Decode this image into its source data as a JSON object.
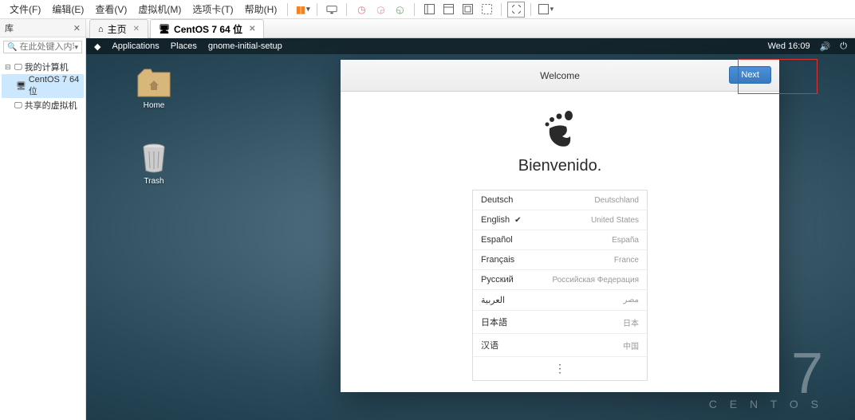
{
  "menubar": {
    "items": [
      "文件(F)",
      "编辑(E)",
      "查看(V)",
      "虚拟机(M)",
      "选项卡(T)",
      "帮助(H)"
    ]
  },
  "sidebar": {
    "title": "库",
    "search_placeholder": "在此处键入内容...",
    "tree": {
      "root": "我的计算机",
      "child1": "CentOS 7 64 位",
      "child2": "共享的虚拟机"
    }
  },
  "tabs": {
    "home": "主页",
    "vm": "CentOS 7 64 位"
  },
  "gnome": {
    "applications": "Applications",
    "places": "Places",
    "process": "gnome-initial-setup",
    "clock": "Wed 16:09"
  },
  "desktop": {
    "home": "Home",
    "trash": "Trash"
  },
  "welcome": {
    "title": "Welcome",
    "next": "Next",
    "greeting": "Bienvenido.",
    "languages": [
      {
        "lang": "Deutsch",
        "country": "Deutschland",
        "selected": false
      },
      {
        "lang": "English",
        "country": "United States",
        "selected": true
      },
      {
        "lang": "Español",
        "country": "España",
        "selected": false
      },
      {
        "lang": "Français",
        "country": "France",
        "selected": false
      },
      {
        "lang": "Русский",
        "country": "Российская Федерация",
        "selected": false
      },
      {
        "lang": "العربية",
        "country": "مصر",
        "selected": false
      },
      {
        "lang": "日本語",
        "country": "日本",
        "selected": false
      },
      {
        "lang": "汉语",
        "country": "中国",
        "selected": false
      }
    ],
    "more": "⋮"
  },
  "centos": {
    "version": "7",
    "name": "C E N T O S"
  }
}
